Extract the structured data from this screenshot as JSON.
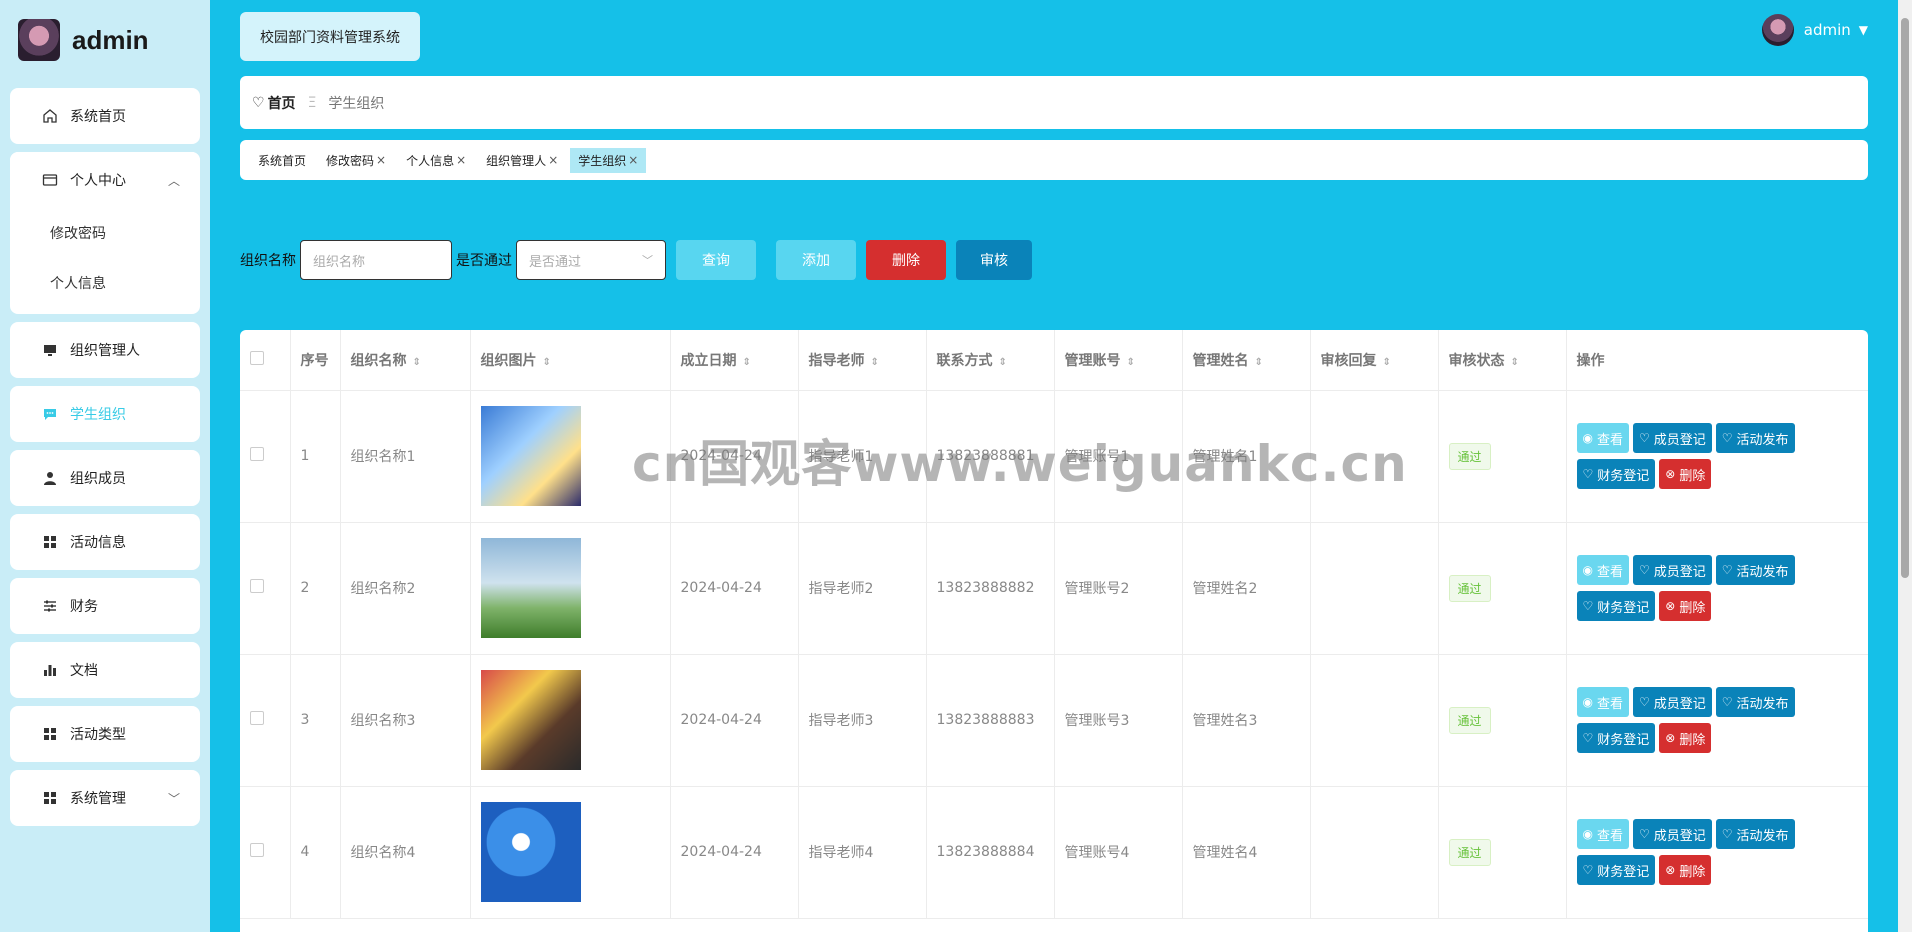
{
  "brand": {
    "name": "admin"
  },
  "sidebar": {
    "items": [
      {
        "label": "系统首页",
        "icon": "home-icon"
      },
      {
        "label": "个人中心",
        "icon": "profile-card-icon",
        "children": [
          "修改密码",
          "个人信息"
        ]
      },
      {
        "label": "组织管理人",
        "icon": "monitor-icon"
      },
      {
        "label": "学生组织",
        "icon": "chat-icon",
        "active": true
      },
      {
        "label": "组织成员",
        "icon": "user-icon"
      },
      {
        "label": "活动信息",
        "icon": "grid-icon"
      },
      {
        "label": "财务",
        "icon": "sliders-icon"
      },
      {
        "label": "文档",
        "icon": "bar-chart-icon"
      },
      {
        "label": "活动类型",
        "icon": "grid-icon"
      },
      {
        "label": "系统管理",
        "icon": "grid-icon"
      }
    ]
  },
  "header": {
    "system_title": "校园部门资料管理系统",
    "user": "admin"
  },
  "breadcrumb": {
    "home": "首页",
    "current": "学生组织"
  },
  "tags": [
    "系统首页",
    "修改密码",
    "个人信息",
    "组织管理人",
    "学生组织"
  ],
  "search": {
    "name_label": "组织名称",
    "name_placeholder": "组织名称",
    "pass_label": "是否通过",
    "pass_placeholder": "是否通过",
    "query": "查询",
    "add": "添加",
    "delete": "删除",
    "audit": "审核"
  },
  "table": {
    "headers": [
      "序号",
      "组织名称",
      "组织图片",
      "成立日期",
      "指导老师",
      "联系方式",
      "管理账号",
      "管理姓名",
      "审核回复",
      "审核状态",
      "操作"
    ],
    "rows": [
      {
        "no": "1",
        "name": "组织名称1",
        "date": "2024-04-24",
        "teacher": "指导老师1",
        "contact": "13823888881",
        "account": "管理账号1",
        "manager": "管理姓名1",
        "reply": "",
        "status": "通过"
      },
      {
        "no": "2",
        "name": "组织名称2",
        "date": "2024-04-24",
        "teacher": "指导老师2",
        "contact": "13823888882",
        "account": "管理账号2",
        "manager": "管理姓名2",
        "reply": "",
        "status": "通过"
      },
      {
        "no": "3",
        "name": "组织名称3",
        "date": "2024-04-24",
        "teacher": "指导老师3",
        "contact": "13823888883",
        "account": "管理账号3",
        "manager": "管理姓名3",
        "reply": "",
        "status": "通过"
      },
      {
        "no": "4",
        "name": "组织名称4",
        "date": "2024-04-24",
        "teacher": "指导老师4",
        "contact": "13823888884",
        "account": "管理账号4",
        "manager": "管理姓名4",
        "reply": "",
        "status": "通过"
      }
    ],
    "ops": {
      "view": "查看",
      "member": "成员登记",
      "activity": "活动发布",
      "finance": "财务登记",
      "delete": "删除"
    }
  },
  "watermark": "cn国观客www.weiguankc.cn",
  "colors": {
    "bg": "#15c0e8",
    "sidebar": "#c9edf7",
    "accent": "#38cbe6",
    "blue": "#0a83b9",
    "red": "#d52f2f"
  }
}
